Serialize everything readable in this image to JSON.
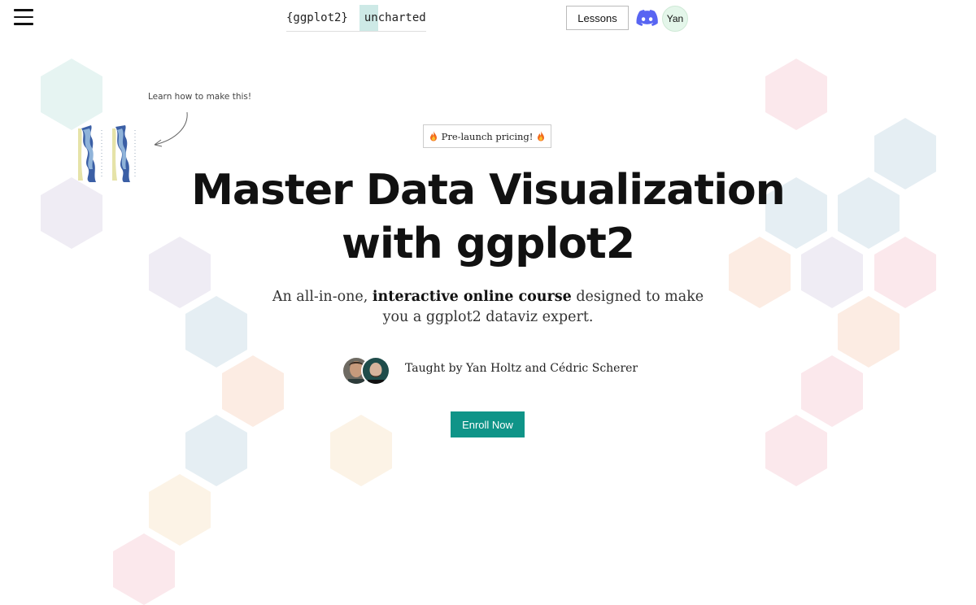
{
  "header": {
    "menu_icon": "hamburger-menu-icon",
    "logo": {
      "part1": "{ggplot2}",
      "part2": "uncharted"
    },
    "lessons_label": "Lessons",
    "discord_icon": "discord-icon",
    "user_initials": "Yan"
  },
  "annotation": {
    "text": "Learn how to make this!"
  },
  "hero": {
    "badge_text": "Pre-launch pricing!",
    "badge_icon": "fire-icon",
    "headline_line1": "Master Data Visualization",
    "headline_line2": "with ggplot2",
    "sub_prefix": "An all-in-one, ",
    "sub_bold": "interactive online course",
    "sub_suffix": " designed to make",
    "sub_line2": "you a ggplot2 dataviz expert.",
    "taught_by": "Taught by Yan Holtz and Cédric Scherer",
    "enroll_label": "Enroll Now"
  },
  "colors": {
    "accent": "#0f9488",
    "hex_teal": "#e6f4f2",
    "hex_lavender": "#efecf4",
    "hex_blue": "#e5eef3",
    "hex_peach": "#fcece3",
    "hex_cream": "#fcf3e6",
    "hex_pink": "#fbe8ec"
  }
}
